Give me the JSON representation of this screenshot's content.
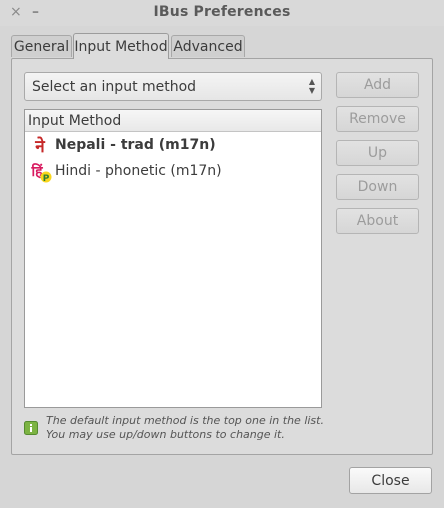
{
  "window": {
    "title": "IBus Preferences",
    "close_glyph": "×",
    "minimize_glyph": "–"
  },
  "tabs": [
    {
      "label": "General",
      "active": false
    },
    {
      "label": "Input Method",
      "active": true
    },
    {
      "label": "Advanced",
      "active": false
    }
  ],
  "combo": {
    "value": "Select an input method",
    "arrow_up": "▲",
    "arrow_down": "▼"
  },
  "list": {
    "header": "Input Method",
    "items": [
      {
        "label": "Nepali - trad (m17n)",
        "icon": "nepali-script-icon",
        "icon_glyph": "ने",
        "bold": true
      },
      {
        "label": "Hindi - phonetic (m17n)",
        "icon": "hindi-phonetic-icon",
        "icon_glyph": "हिं",
        "icon_badge": "P",
        "bold": false
      }
    ]
  },
  "buttons": {
    "add": "Add",
    "remove": "Remove",
    "up": "Up",
    "down": "Down",
    "about": "About",
    "close": "Close"
  },
  "info": {
    "line1": "The default input method is the top one in the list.",
    "line2": "You may use up/down buttons to change it.",
    "icon": "info-icon"
  },
  "colors": {
    "window_bg": "#d6d6d6",
    "list_bg": "#ffffff",
    "nepali_icon": "#c62828",
    "hindi_icon": "#d81b60",
    "info_icon": "#7cb342"
  }
}
